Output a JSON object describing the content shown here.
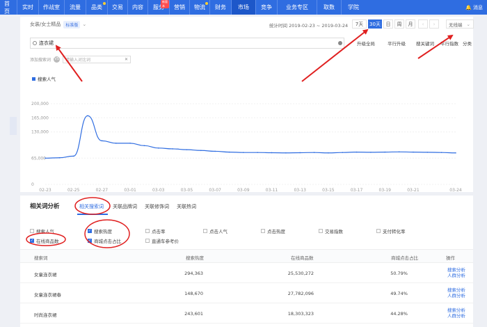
{
  "topnav": {
    "items": [
      {
        "label": "首页"
      },
      {
        "label": "实时"
      },
      {
        "label": "作战室"
      },
      {
        "label": "流量"
      },
      {
        "label": "品类",
        "dot": true
      },
      {
        "label": "交易"
      },
      {
        "label": "内容"
      },
      {
        "label": "服务",
        "badge": "新版本"
      },
      {
        "label": "营销"
      },
      {
        "label": "物流",
        "dot": true
      },
      {
        "label": "财务"
      },
      {
        "label": "市场",
        "active": true
      },
      {
        "label": "竞争"
      },
      {
        "label": "业务专区"
      },
      {
        "label": "取数"
      },
      {
        "label": "学院"
      }
    ],
    "message": "消息"
  },
  "filters": {
    "category": "女装/女士精品",
    "tag": "标准版",
    "date_range": "统计时间 2019-02-23 ~ 2019-03-24",
    "ranges": [
      "7天",
      "30天",
      "日",
      "周",
      "月"
    ],
    "active_range": "30天",
    "industry": "无线端"
  },
  "search": {
    "value": "连衣裙",
    "options": [
      "升级全局",
      "平行升级",
      "搜关键词",
      "平行指数",
      "分类"
    ]
  },
  "compare": {
    "label": "添加搜索词",
    "vs": "VS",
    "placeholder": "请输入对比词"
  },
  "chart_data": {
    "type": "line",
    "legend": "搜索人气",
    "x": [
      "02-23",
      "02-24",
      "02-25",
      "02-26",
      "02-27",
      "02-28",
      "03-01",
      "03-02",
      "03-03",
      "03-04",
      "03-05",
      "03-06",
      "03-07",
      "03-08",
      "03-09",
      "03-10",
      "03-11",
      "03-12",
      "03-13",
      "03-14",
      "03-15",
      "03-16",
      "03-17",
      "03-18",
      "03-19",
      "03-20",
      "03-21",
      "03-22",
      "03-23",
      "03-24"
    ],
    "values": [
      65000,
      66000,
      70000,
      170000,
      108000,
      102000,
      102000,
      96000,
      90000,
      88000,
      86000,
      84000,
      82000,
      80000,
      79000,
      79000,
      78500,
      78000,
      78500,
      79000,
      78000,
      79000,
      80000,
      79500,
      80000,
      80500,
      80000,
      79500,
      79000,
      78000
    ],
    "xticks": [
      "02-23",
      "02-25",
      "02-27",
      "03-01",
      "03-03",
      "03-05",
      "03-07",
      "03-09",
      "03-11",
      "03-13",
      "03-15",
      "03-17",
      "03-19",
      "03-21",
      "03-24"
    ],
    "yticks": [
      200000,
      165000,
      130000,
      65000,
      0
    ],
    "ytick_labels": [
      "200,000",
      "165,000",
      "130,000",
      "65,000",
      "0"
    ],
    "ylim": [
      0,
      200000
    ],
    "color": "#2f6de1"
  },
  "related": {
    "title": "相关词分析",
    "tabs": [
      "相关搜索词",
      "关联品牌词",
      "关联修饰词",
      "关联热词"
    ],
    "active_tab": 0,
    "metrics": [
      {
        "label": "搜索人气",
        "checked": false
      },
      {
        "label": "搜索热度",
        "checked": true
      },
      {
        "label": "点击率",
        "checked": false
      },
      {
        "label": "点击人气",
        "checked": false
      },
      {
        "label": "点击热度",
        "checked": false
      },
      {
        "label": "交易指数",
        "checked": false
      },
      {
        "label": "支付转化率",
        "checked": false
      },
      {
        "label": "在线商品数",
        "checked": true
      },
      {
        "label": "商城点击占比",
        "checked": true
      },
      {
        "label": "直通车参考价",
        "checked": false
      }
    ],
    "columns": [
      "搜索词",
      "搜索热度",
      "在线商品数",
      "商城点击占比",
      "操作"
    ],
    "rows": [
      {
        "word": "女童连衣裙",
        "heat": "294,363",
        "goods": "25,530,272",
        "ratio": "50.79%",
        "action1": "搜索分析",
        "action2": "人群分析"
      },
      {
        "word": "女童连衣裙春",
        "heat": "148,670",
        "goods": "27,782,096",
        "ratio": "49.74%",
        "action1": "搜索分析",
        "action2": "人群分析"
      },
      {
        "word": "时尚连衣裙",
        "heat": "243,601",
        "goods": "18,303,323",
        "ratio": "44.28%",
        "action1": "搜索分析",
        "action2": "人群分析"
      }
    ]
  },
  "colors": {
    "brand": "#2f6de1",
    "annotation": "#e02020"
  }
}
